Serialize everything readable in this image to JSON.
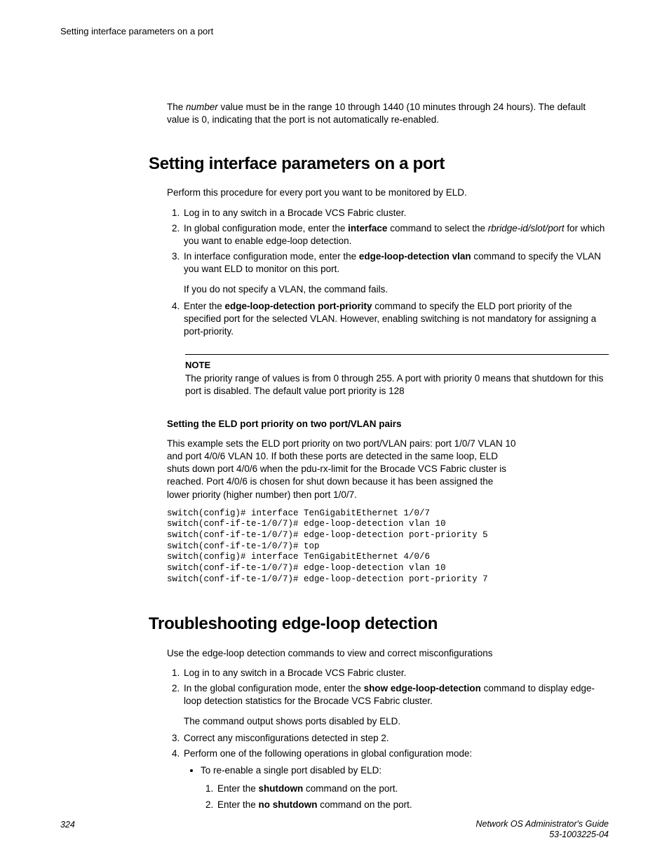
{
  "running_header": "Setting interface parameters on a port",
  "intro_para_pre": "The ",
  "intro_para_em": "number",
  "intro_para_post": " value must be in the range 10 through 1440 (10 minutes through 24 hours). The default value is 0, indicating that the port is not automatically re-enabled.",
  "section1": {
    "title": "Setting interface parameters on a port",
    "p1": "Perform this procedure for every port you want to be monitored by ELD.",
    "ol": {
      "i1": "Log in to any switch in a Brocade VCS Fabric cluster.",
      "i2_a": "In global configuration mode, enter the ",
      "i2_b": "interface",
      "i2_c": " command to select the ",
      "i2_d": "rbridge-id/slot/port",
      "i2_e": " for which you want to enable edge-loop detection.",
      "i3_a": "In interface configuration mode, enter the ",
      "i3_b": "edge-loop-detection vlan",
      "i3_c": " command to specify the VLAN you want ELD to monitor on this port.",
      "i3_p2": "If you do not specify a VLAN, the command fails.",
      "i4_a": "Enter the ",
      "i4_b": "edge-loop-detection port-priority",
      "i4_c": " command to specify the ELD port priority of the specified port for the selected VLAN. However, enabling switching is not mandatory for assigning a port-priority."
    },
    "note_label": "NOTE",
    "note_text": "The priority range of values is from 0 through 255. A port with priority 0 means that shutdown for this port is disabled. The default value port priority is 128",
    "subhead": "Setting the ELD port priority on two port/VLAN pairs",
    "example_p": "This example sets the ELD port priority on two port/VLAN pairs: port 1/0/7 VLAN 10 and port 4/0/6 VLAN 10. If both these ports are detected in the same loop, ELD shuts down port 4/0/6 when the pdu-rx-limit for the Brocade VCS Fabric cluster is reached. Port 4/0/6 is chosen for shut down because it has been assigned the lower priority (higher number) then port 1/0/7.",
    "code": "switch(config)# interface TenGigabitEthernet 1/0/7\nswitch(conf-if-te-1/0/7)# edge-loop-detection vlan 10\nswitch(conf-if-te-1/0/7)# edge-loop-detection port-priority 5\nswitch(conf-if-te-1/0/7)# top\nswitch(config)# interface TenGigabitEthernet 4/0/6\nswitch(conf-if-te-1/0/7)# edge-loop-detection vlan 10\nswitch(conf-if-te-1/0/7)# edge-loop-detection port-priority 7"
  },
  "section2": {
    "title": "Troubleshooting edge-loop detection",
    "p1": "Use the edge-loop detection commands to view and correct misconfigurations",
    "ol": {
      "i1": "Log in to any switch in a Brocade VCS Fabric cluster.",
      "i2_a": "In the global configuration mode, enter the ",
      "i2_b": "show edge-loop-detection",
      "i2_c": " command to display edge-loop detection statistics for the Brocade VCS Fabric cluster.",
      "i2_p2": "The command output shows ports disabled by ELD.",
      "i3": "Correct any misconfigurations detected in step 2.",
      "i4": "Perform one of the following operations in global configuration mode:",
      "i4_bullet": "To re-enable a single port disabled by ELD:",
      "i4_sub1_a": "Enter the ",
      "i4_sub1_b": "shutdown",
      "i4_sub1_c": " command on the port.",
      "i4_sub2_a": "Enter the ",
      "i4_sub2_b": "no shutdown",
      "i4_sub2_c": " command on the port."
    }
  },
  "footer": {
    "page_num": "324",
    "title": "Network OS Administrator's Guide",
    "docnum": "53-1003225-04"
  }
}
